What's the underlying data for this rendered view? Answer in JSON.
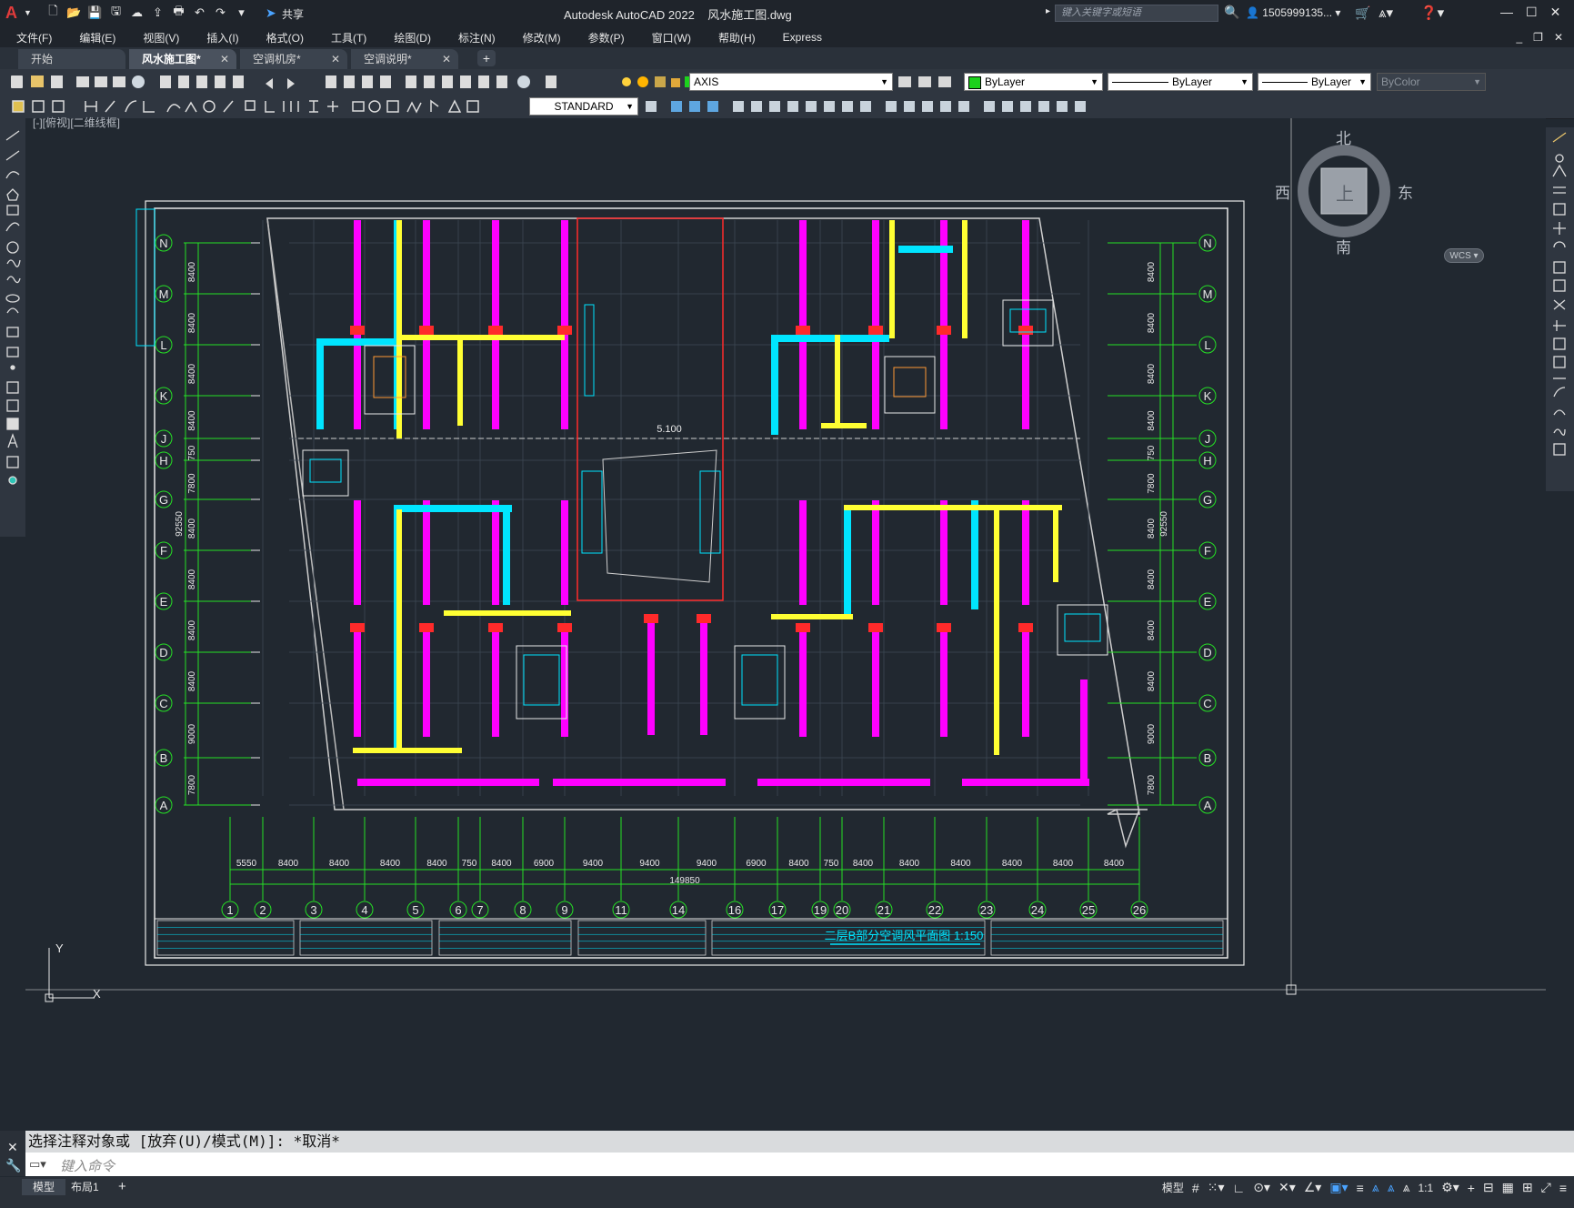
{
  "app": {
    "logo": "A",
    "title": "Autodesk AutoCAD 2022",
    "filename": "风水施工图.dwg",
    "share_label": "共享",
    "search_placeholder": "键入关键字或短语",
    "user": "1505999135...",
    "accent_color": "#e23b3b"
  },
  "menu": [
    "文件(F)",
    "编辑(E)",
    "视图(V)",
    "插入(I)",
    "格式(O)",
    "工具(T)",
    "绘图(D)",
    "标注(N)",
    "修改(M)",
    "参数(P)",
    "窗口(W)",
    "帮助(H)",
    "Express"
  ],
  "tabs": [
    {
      "label": "开始",
      "active": false
    },
    {
      "label": "风水施工图*",
      "active": true
    },
    {
      "label": "空调机房*",
      "active": false
    },
    {
      "label": "空调说明*",
      "active": false
    }
  ],
  "toolbar": {
    "layer": "AXIS",
    "layer_color": "#00ff00",
    "color": "ByLayer",
    "linetype": "ByLayer",
    "lineweight": "ByLayer",
    "plotstyle": "ByColor",
    "textstyle": "STANDARD"
  },
  "viewport": {
    "label": "[-][俯视][二维线框]",
    "compass": {
      "n": "北",
      "s": "南",
      "w": "西",
      "e": "东",
      "top": "上"
    },
    "ucs": "WCS"
  },
  "drawing": {
    "rows": [
      "N",
      "M",
      "L",
      "K",
      "J",
      "H",
      "G",
      "F",
      "E",
      "D",
      "C",
      "B",
      "A"
    ],
    "row_dims": [
      "8400",
      "8400",
      "8400",
      "8400",
      "750",
      "7800",
      "8400",
      "8400",
      "8400",
      "8400",
      "9000",
      "7800"
    ],
    "total_row_dim": "92550",
    "columns": [
      "1",
      "2",
      "3",
      "4",
      "5",
      "6",
      "7",
      "8",
      "9",
      "11",
      "14",
      "16",
      "17",
      "19",
      "20",
      "21",
      "22",
      "23",
      "24",
      "25",
      "26"
    ],
    "col_dims": [
      "5550",
      "8400",
      "8400",
      "8400",
      "8400",
      "750",
      "8400",
      "6900",
      "9400",
      "9400",
      "9400",
      "6900",
      "8400",
      "750",
      "8400",
      "8400",
      "8400",
      "8400",
      "8400",
      "8400"
    ],
    "total_col_dim": "149850",
    "elevation": "5.100",
    "title": "二层B部分空调风平面图 1:150",
    "axis_x": "X",
    "axis_y": "Y"
  },
  "command": {
    "history": "选择注释对象或 [放弃(U)/模式(M)]: *取消*",
    "placeholder": "键入命令"
  },
  "status": {
    "tabs": [
      "模型",
      "布局1"
    ],
    "model_label": "模型",
    "scale": "1:1"
  }
}
